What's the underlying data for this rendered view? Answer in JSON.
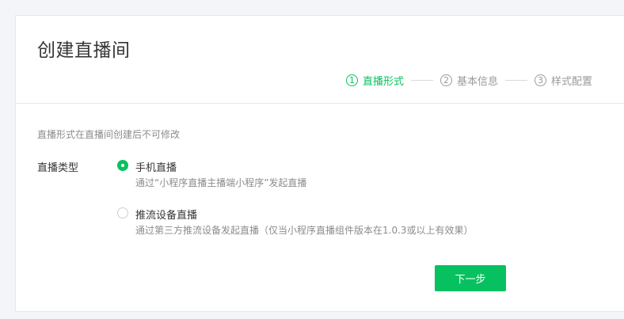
{
  "page": {
    "title": "创建直播间"
  },
  "steps": [
    {
      "num": "1",
      "label": "直播形式",
      "active": true
    },
    {
      "num": "2",
      "label": "基本信息",
      "active": false
    },
    {
      "num": "3",
      "label": "样式配置",
      "active": false
    }
  ],
  "form": {
    "notice": "直播形式在直播间创建后不可修改",
    "type_label": "直播类型",
    "options": [
      {
        "title": "手机直播",
        "desc": "通过“小程序直播主播端小程序”发起直播",
        "checked": true
      },
      {
        "title": "推流设备直播",
        "desc": "通过第三方推流设备发起直播（仅当小程序直播组件版本在1.0.3或以上有效果）",
        "checked": false
      }
    ],
    "next_label": "下一步"
  },
  "colors": {
    "accent": "#07c160",
    "muted": "#9a9a9a",
    "border": "#e7e7eb"
  }
}
